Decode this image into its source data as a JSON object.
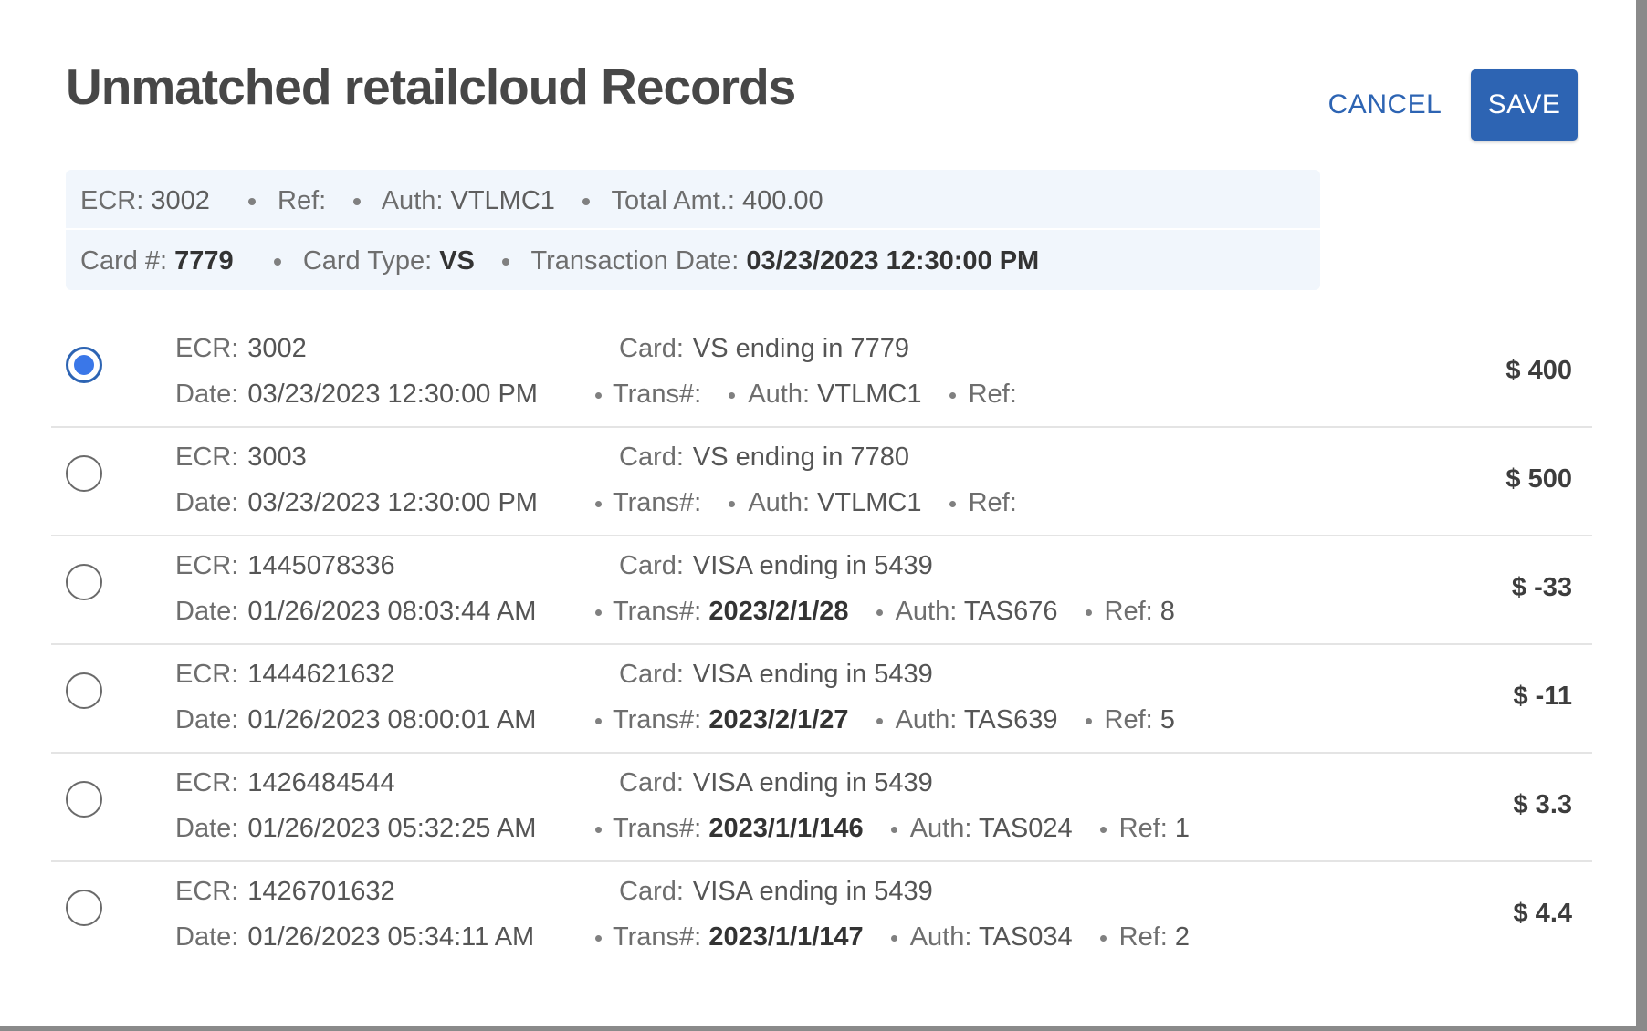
{
  "dialog": {
    "title": "Unmatched retailcloud Records",
    "cancel_label": "CANCEL",
    "save_label": "SAVE"
  },
  "summary": {
    "ecr_label": "ECR:",
    "ecr": "3002",
    "ref_label": "Ref:",
    "ref": "",
    "auth_label": "Auth:",
    "auth": "VTLMC1",
    "total_label": "Total Amt.:",
    "total": "400.00",
    "card_label": "Card #:",
    "card": "7779",
    "card_type_label": "Card Type:",
    "card_type": "VS",
    "trans_date_label": "Transaction Date:",
    "trans_date": "03/23/2023 12:30:00 PM"
  },
  "labels": {
    "ecr": "ECR:",
    "date": "Date:",
    "card": "Card:",
    "trans": "Trans#:",
    "auth": "Auth:",
    "ref": "Ref:"
  },
  "records": [
    {
      "selected": true,
      "ecr": "3002",
      "date": "03/23/2023 12:30:00 PM",
      "card": "VS ending in 7779",
      "trans": "",
      "auth": "VTLMC1",
      "ref": "",
      "amount": "$ 400"
    },
    {
      "selected": false,
      "ecr": "3003",
      "date": "03/23/2023 12:30:00 PM",
      "card": "VS ending in 7780",
      "trans": "",
      "auth": "VTLMC1",
      "ref": "",
      "amount": "$ 500"
    },
    {
      "selected": false,
      "ecr": "1445078336",
      "date": "01/26/2023 08:03:44 AM",
      "card": "VISA ending in 5439",
      "trans": "2023/2/1/28",
      "auth": "TAS676",
      "ref": "8",
      "amount": "$ -33"
    },
    {
      "selected": false,
      "ecr": "1444621632",
      "date": "01/26/2023 08:00:01 AM",
      "card": "VISA ending in 5439",
      "trans": "2023/2/1/27",
      "auth": "TAS639",
      "ref": "5",
      "amount": "$ -11"
    },
    {
      "selected": false,
      "ecr": "1426484544",
      "date": "01/26/2023 05:32:25 AM",
      "card": "VISA ending in 5439",
      "trans": "2023/1/1/146",
      "auth": "TAS024",
      "ref": "1",
      "amount": "$ 3.3"
    },
    {
      "selected": false,
      "ecr": "1426701632",
      "date": "01/26/2023 05:34:11 AM",
      "card": "VISA ending in 5439",
      "trans": "2023/1/1/147",
      "auth": "TAS034",
      "ref": "2",
      "amount": "$ 4.4"
    }
  ]
}
